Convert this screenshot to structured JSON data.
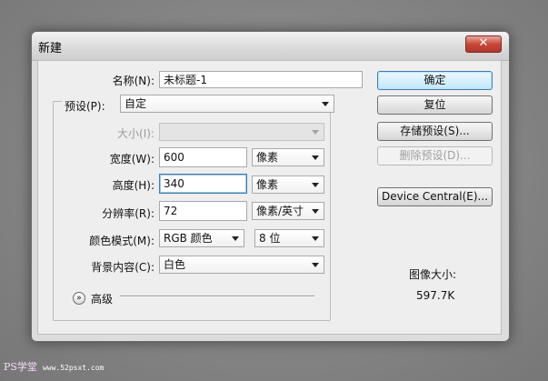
{
  "window": {
    "title": "新建",
    "close_label": "✕"
  },
  "form": {
    "name": {
      "label": "名称(N):",
      "value": "未标题-1"
    },
    "preset": {
      "label": "预设(P):",
      "value": "自定"
    },
    "size": {
      "label": "大小(I):",
      "value": ""
    },
    "width": {
      "label": "宽度(W):",
      "value": "600",
      "unit": "像素"
    },
    "height": {
      "label": "高度(H):",
      "value": "340",
      "unit": "像素"
    },
    "resolution": {
      "label": "分辨率(R):",
      "value": "72",
      "unit": "像素/英寸"
    },
    "color_mode": {
      "label": "颜色模式(M):",
      "mode": "RGB 颜色",
      "depth": "8 位"
    },
    "background": {
      "label": "背景内容(C):",
      "value": "白色"
    },
    "advanced_label": "高级"
  },
  "buttons": {
    "ok": "确定",
    "reset": "复位",
    "save_preset": "存储预设(S)...",
    "delete_preset": "删除预设(D)...",
    "device_central": "Device Central(E)..."
  },
  "image_size": {
    "label": "图像大小:",
    "value": "597.7K"
  },
  "watermark": {
    "brand": "PS学堂",
    "url": "www.52psxt.com"
  }
}
